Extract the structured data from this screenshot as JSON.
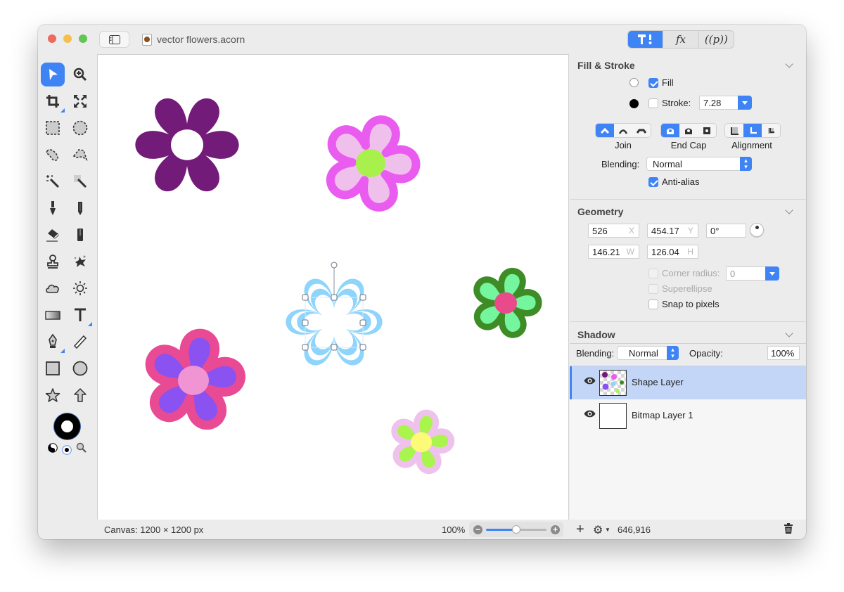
{
  "window": {
    "title": "vector flowers.acorn",
    "mode_tabs": [
      {
        "name": "tools",
        "label": "⚒!",
        "active": true
      },
      {
        "name": "filters",
        "label": "fx",
        "active": false
      },
      {
        "name": "plugins",
        "label": "((p))",
        "active": false
      }
    ]
  },
  "toolbox": {
    "tools": [
      {
        "name": "select",
        "icon": "arrow-pointer-icon",
        "active": true
      },
      {
        "name": "zoom",
        "icon": "magnifier-plus-icon"
      },
      {
        "name": "crop",
        "icon": "crop-icon",
        "submenu": true
      },
      {
        "name": "transform",
        "icon": "expand-arrows-icon"
      },
      {
        "name": "rect-select",
        "icon": "rect-marquee-icon"
      },
      {
        "name": "ellipse-select",
        "icon": "ellipse-marquee-icon"
      },
      {
        "name": "lasso",
        "icon": "lasso-icon"
      },
      {
        "name": "polygon-lasso",
        "icon": "polygon-lasso-icon"
      },
      {
        "name": "magic-wand",
        "icon": "magic-wand-icon"
      },
      {
        "name": "instant-alpha",
        "icon": "instant-alpha-icon"
      },
      {
        "name": "brush",
        "icon": "brush-icon"
      },
      {
        "name": "pencil",
        "icon": "pencil-icon"
      },
      {
        "name": "eraser",
        "icon": "eraser-icon"
      },
      {
        "name": "fill",
        "icon": "paint-bucket-icon"
      },
      {
        "name": "clone",
        "icon": "stamp-icon"
      },
      {
        "name": "smudge",
        "icon": "splatter-icon"
      },
      {
        "name": "burn",
        "icon": "cloud-icon"
      },
      {
        "name": "dodge",
        "icon": "sun-icon"
      },
      {
        "name": "gradient",
        "icon": "gradient-icon"
      },
      {
        "name": "text",
        "icon": "text-icon",
        "submenu": true
      },
      {
        "name": "pen",
        "icon": "pen-nib-icon",
        "submenu": true
      },
      {
        "name": "line",
        "icon": "line-icon"
      },
      {
        "name": "rectangle",
        "icon": "square-shape-icon"
      },
      {
        "name": "oval",
        "icon": "circle-shape-icon"
      },
      {
        "name": "star",
        "icon": "star-icon"
      },
      {
        "name": "arrow",
        "icon": "up-arrow-icon"
      }
    ],
    "colors": {
      "stroke": "#000000",
      "fill": "#ffffff"
    }
  },
  "canvas": {
    "flowers": [
      {
        "name": "purple-six-petal",
        "petal": "#731b78",
        "center": "#ffffff",
        "stroke": null
      },
      {
        "name": "pink-five-petal",
        "petal": "#f0c0ec",
        "center": "#a8f04c",
        "stroke": "#ea5cf0"
      },
      {
        "name": "blue-outline-selected",
        "petal": "#8ed4fb",
        "center": "#ffffff",
        "stroke": null
      },
      {
        "name": "green-five-petal",
        "petal": "#74f59e",
        "center": "#e84a8c",
        "stroke": "#3e8c26"
      },
      {
        "name": "purple-five-petal",
        "petal": "#8a52f0",
        "center": "#f094d4",
        "stroke": "#e94a94"
      },
      {
        "name": "lime-five-petal",
        "petal": "#a9f54e",
        "center": "#fdfa78",
        "stroke": "#eec2ec"
      }
    ]
  },
  "status": {
    "canvas_size": "Canvas: 1200 × 1200 px",
    "zoom": "100%",
    "zoom_slider_fraction": 0.5,
    "coordinates": "646,916"
  },
  "inspector": {
    "fill_stroke": {
      "title": "Fill & Stroke",
      "fill_label": "Fill",
      "fill_checked": true,
      "stroke_label": "Stroke:",
      "stroke_checked": false,
      "stroke_width": "7.28",
      "join_label": "Join",
      "endcap_label": "End Cap",
      "alignment_label": "Alignment",
      "blending_label": "Blending:",
      "blending_value": "Normal",
      "antialias_label": "Anti-alias",
      "antialias_checked": true
    },
    "geometry": {
      "title": "Geometry",
      "x": "526",
      "x_label": "X",
      "y": "454.17",
      "y_label": "Y",
      "rotation": "0°",
      "w": "146.21",
      "w_label": "W",
      "h": "126.04",
      "h_label": "H",
      "corner_radius_label": "Corner radius:",
      "corner_radius": "0",
      "superellipse_label": "Superellipse",
      "snap_label": "Snap to pixels"
    },
    "shadow": {
      "title": "Shadow"
    },
    "layer_controls": {
      "blending_label": "Blending:",
      "blending_value": "Normal",
      "opacity_label": "Opacity:",
      "opacity_value": "100%",
      "opacity_fraction": 1.0
    },
    "layers": [
      {
        "name": "Shape Layer",
        "visible": true,
        "selected": true
      },
      {
        "name": "Bitmap Layer 1",
        "visible": true,
        "selected": false
      }
    ]
  }
}
